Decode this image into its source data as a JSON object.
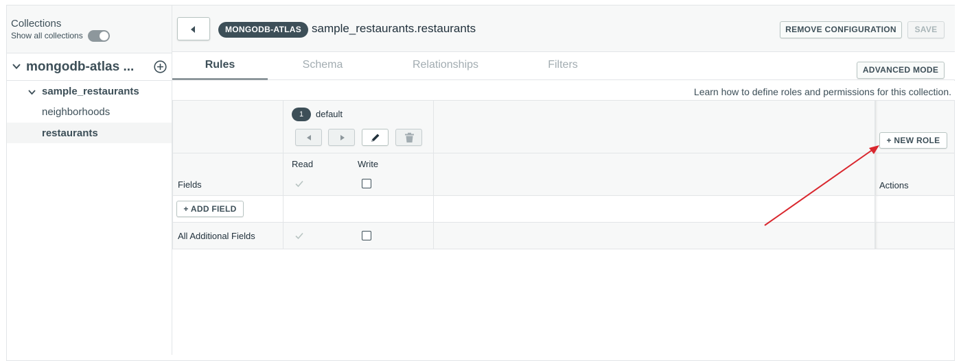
{
  "sidebar": {
    "title": "Collections",
    "show_all_label": "Show all collections",
    "show_all_on": true,
    "database": "mongodb-atlas ...",
    "items": [
      {
        "label": "sample_restaurants",
        "expanded": true
      },
      {
        "label": "neighborhoods"
      },
      {
        "label": "restaurants",
        "selected": true
      }
    ]
  },
  "header": {
    "cluster_badge": "MONGODB-ATLAS",
    "namespace": "sample_restaurants.restaurants",
    "remove_label": "REMOVE CONFIGURATION",
    "save_label": "SAVE"
  },
  "tabs": {
    "items": [
      {
        "label": "Rules",
        "active": true
      },
      {
        "label": "Schema"
      },
      {
        "label": "Relationships"
      },
      {
        "label": "Filters"
      }
    ],
    "advanced_label": "ADVANCED MODE"
  },
  "help_text": "Learn how to define roles and permissions for this collection.",
  "rules": {
    "role": {
      "number": "1",
      "name": "default"
    },
    "new_role_label": "+ NEW ROLE",
    "columns": {
      "fields": "Fields",
      "read": "Read",
      "write": "Write",
      "actions": "Actions"
    },
    "add_field_label": "+ ADD FIELD",
    "rows": [
      {
        "name": "All Additional Fields",
        "read": true,
        "write": false
      }
    ],
    "default_read": true,
    "default_write": false
  },
  "annotation_color": "#d9272e",
  "colors": {
    "badge_bg": "#3d4f58",
    "border": "#e2e5e7",
    "panel_bg": "#f7f8f8"
  }
}
